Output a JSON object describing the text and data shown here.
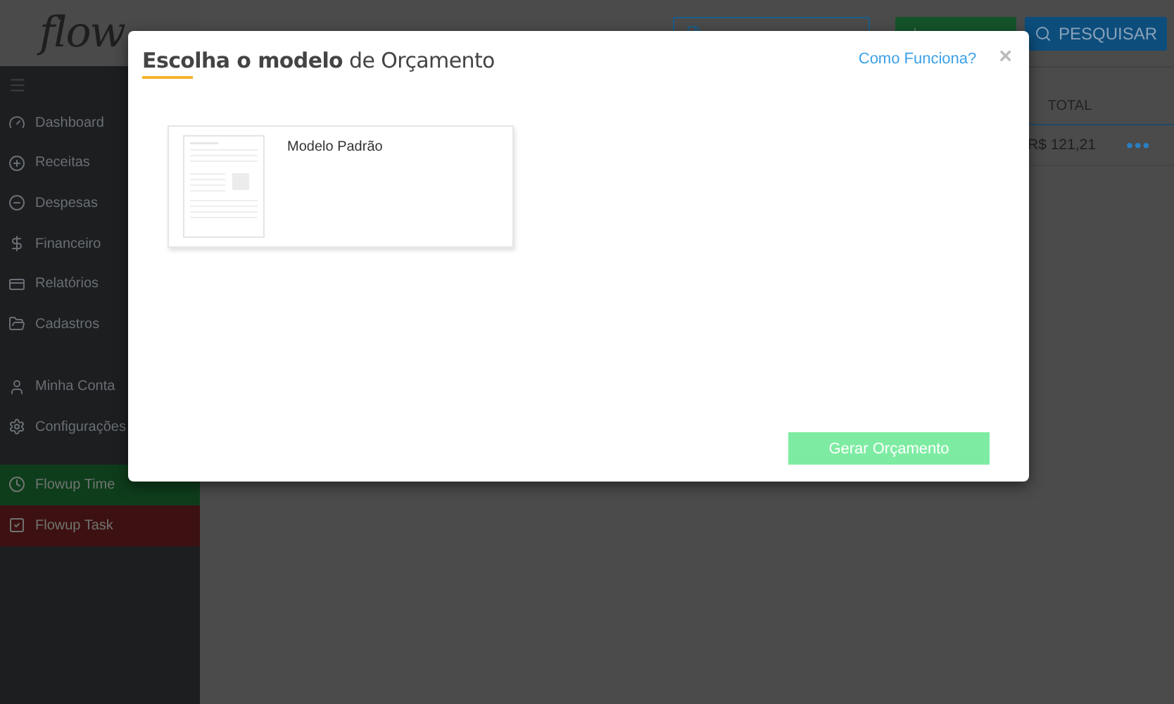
{
  "sidebar": {
    "logo": "flow",
    "groups": [
      [
        {
          "kind": "nav",
          "label": "Dashboard"
        },
        {
          "kind": "nav",
          "label": "Receitas"
        },
        {
          "kind": "nav",
          "label": "Despesas"
        },
        {
          "kind": "nav",
          "label": "Financeiro"
        },
        {
          "kind": "nav",
          "label": "Relatórios"
        },
        {
          "kind": "nav",
          "label": "Cadastros"
        }
      ],
      [
        {
          "kind": "nav",
          "label": "Minha Conta"
        },
        {
          "kind": "nav",
          "label": "Configurações"
        }
      ],
      [
        {
          "kind": "app",
          "label": "Flowup Time",
          "color": "#0e3d1c"
        },
        {
          "kind": "app",
          "label": "Flowup Task",
          "color": "#3d1011"
        }
      ]
    ]
  },
  "toolbar": {
    "search_button": "PESQUISAR"
  },
  "table": {
    "columns": [
      "TOTAL"
    ],
    "rows": [
      {
        "cells": [
          "R$ 121,21"
        ],
        "menu": "•••"
      }
    ]
  },
  "modal": {
    "title": "**Escolha o modelo** de Orçamento",
    "help_link": "Como Funciona?",
    "close": "×",
    "templates": [
      {
        "name": "Modelo Padrão"
      }
    ],
    "submit": {
      "label": "Gerar Orçamento",
      "disabled": true
    }
  }
}
